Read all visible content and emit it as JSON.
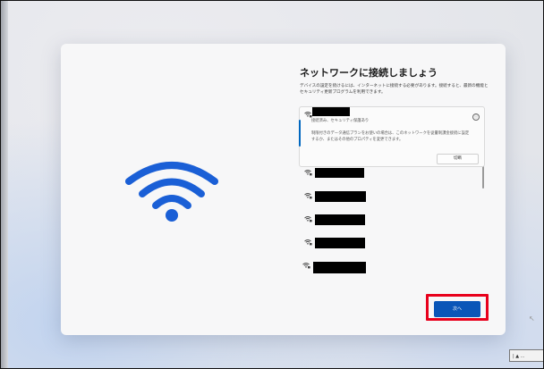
{
  "setup": {
    "title": "ネットワークに接続しましょう",
    "description": "デバイスの設定を続けるには、インターネットに接続する必要があります。接続すると、最新の機能とセキュリティ更新プログラムを利用できます。",
    "selected_network": {
      "status": "接続済み、セキュリティ保護あり",
      "metered_notice": "制限付きのデータ通信プランをお使いの場合は、このネットワークを従量制課金接続に設定するか、またはその他のプロパティを変更できます。",
      "disconnect_label": "切断",
      "info_icon_glyph": "ⓘ"
    },
    "next_label": "次へ"
  },
  "icons": {
    "wifi_illustration": "wifi-icon",
    "network_secured": "wifi-lock-icon",
    "info": "info-icon"
  },
  "colors": {
    "wifi_blue": "#1a5fd6",
    "next_button": "#0a56b8",
    "highlight": "#e8001c",
    "accent": "#0067c0"
  },
  "overlay": {
    "corner_text": "| ▲ ..."
  }
}
